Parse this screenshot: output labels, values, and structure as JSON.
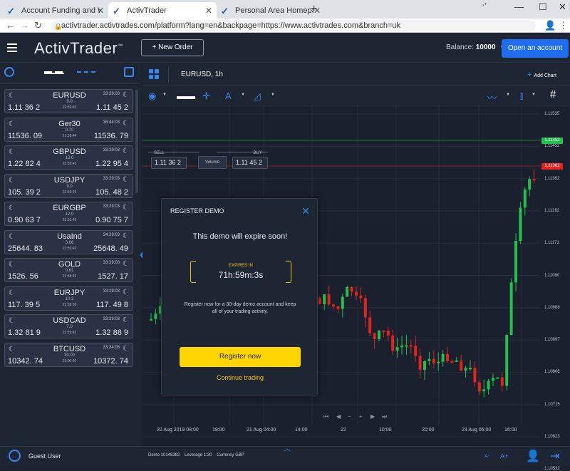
{
  "browser": {
    "tabs": [
      {
        "label": "Account Funding and Withdrawa"
      },
      {
        "label": "ActivTrader"
      },
      {
        "label": "Personal Area Homepage"
      }
    ],
    "url": "activtrader.activtrades.com/platform?lang=en&backpage=https://www.activtrades.com&branch=uk"
  },
  "header": {
    "logo": "ActivTrader",
    "logo_mark": "™",
    "new_order": "New Order",
    "balance_label": "Balance:",
    "balance_value": "10000",
    "open_account": "Open an account"
  },
  "watchlist": [
    {
      "symbol": "EURUSD",
      "time": "33:29:03",
      "spread": "9.0",
      "stime": "22:59:45",
      "sell": "1.11 36 2",
      "buy": "1.11 45 2"
    },
    {
      "symbol": "Ger30",
      "time": "36:44:03",
      "spread": "0.70",
      "stime": "21:59:44",
      "sell": "11536. 09",
      "buy": "11536. 79"
    },
    {
      "symbol": "GBPUSD",
      "time": "33:29:03",
      "spread": "13.0",
      "stime": "22:59:45",
      "sell": "1.22 82 4",
      "buy": "1.22 95 4"
    },
    {
      "symbol": "USDJPY",
      "time": "33:29:03",
      "spread": "9.0",
      "stime": "22:59:45",
      "sell": "105. 39 2",
      "buy": "105. 48 2"
    },
    {
      "symbol": "EURGBP",
      "time": "33:29:03",
      "spread": "12.0",
      "stime": "22:59:45",
      "sell": "0.90 63 7",
      "buy": "0.90 75 7"
    },
    {
      "symbol": "UsaInd",
      "time": "34:29:03",
      "spread": "3.66",
      "stime": "22:59:45",
      "sell": "25644. 83",
      "buy": "25648. 49"
    },
    {
      "symbol": "GOLD",
      "time": "33:29:03",
      "spread": "0.61",
      "stime": "22:58:59",
      "sell": "1526. 56",
      "buy": "1527. 17"
    },
    {
      "symbol": "EURJPY",
      "time": "33:29:03",
      "spread": "10.3",
      "stime": "22:59:38",
      "sell": "117. 39 5",
      "buy": "117. 49 8"
    },
    {
      "symbol": "USDCAD",
      "time": "33:29:03",
      "spread": "7.0",
      "stime": "22:59:42",
      "sell": "1.32 81 9",
      "buy": "1.32 88 9"
    },
    {
      "symbol": "BTCUSD",
      "time": "33:34:05",
      "spread": "30.00",
      "stime": "23:00:00",
      "sell": "10342. 74",
      "buy": "10372. 74"
    }
  ],
  "chart": {
    "tab_label": "EURUSD, 1h",
    "add_chart": "Add Chart",
    "trade": {
      "sell_label": "SELL",
      "buy_label": "BUY",
      "sell": "1.11 36 2",
      "buy": "1.11 45 2",
      "volume": "Volume"
    },
    "price_labels": [
      "1.11535",
      "1.11452",
      "1.11362",
      "1.11262",
      "1.11171",
      "1.11080",
      "1.10988",
      "1.10897",
      "1.10806",
      "1.10715",
      "1.10623",
      "1.10532"
    ],
    "buy_tag": "1.11452",
    "sell_tag": "1.11362",
    "time_labels": [
      "20 Aug 2019 08:00",
      "18:00",
      "21 Aug 04:00",
      "14:00",
      "22",
      "10:00",
      "20:00",
      "23 Aug 06:00",
      "16:00"
    ],
    "colors": {
      "up": "#22c04c",
      "down": "#e0241e"
    }
  },
  "modal": {
    "title": "REGISTER DEMO",
    "headline": "This demo will expire soon!",
    "expires_label": "EXPIRES IN",
    "expires_value": "71h:59m:3s",
    "body": "Register now for a 30-day demo account and keep all of your trading activity.",
    "register": "Register now",
    "continue": "Continue trading"
  },
  "footer": {
    "user": "Guest User",
    "info": "Demo 10146382    Leverage 1:30    Currency GBP",
    "font_small": "A-",
    "font_large": "A+"
  }
}
